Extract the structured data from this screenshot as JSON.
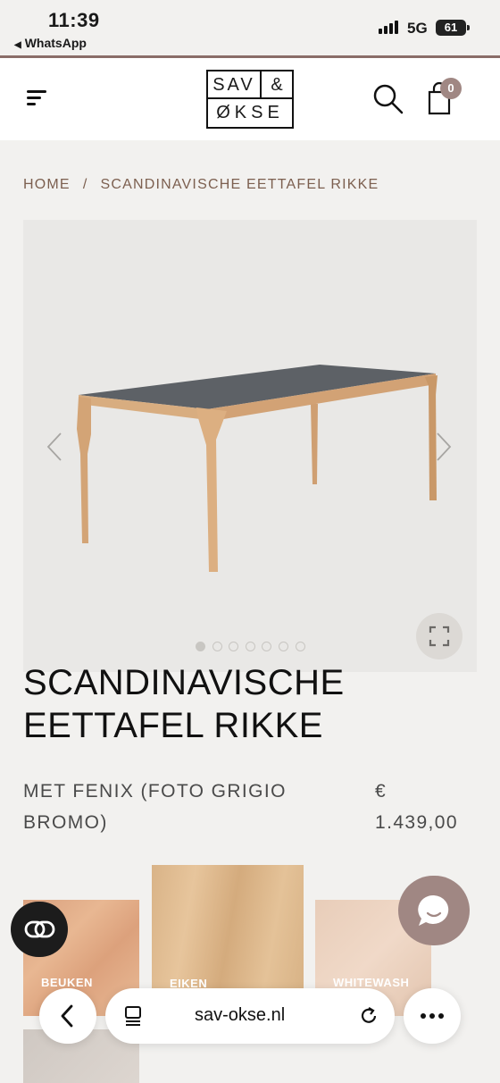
{
  "status_bar": {
    "time": "11:39",
    "back_app": "WhatsApp",
    "network": "5G",
    "battery": "61"
  },
  "header": {
    "logo_line1_left": "SAV",
    "logo_line1_right": "&",
    "logo_line2": "ØKSE",
    "cart_count": "0",
    "icons": [
      "menu-icon",
      "search-icon",
      "shopping-bag-icon"
    ]
  },
  "breadcrumb": {
    "home": "HOME",
    "separator": "/",
    "current": "SCANDINAVISCHE EETTAFEL RIKKE"
  },
  "gallery": {
    "slide_count": 7,
    "active_index": 0,
    "icons": [
      "chevron-left-icon",
      "chevron-right-icon",
      "fullscreen-icon"
    ]
  },
  "product": {
    "title_line1": "SCANDINAVISCHE",
    "title_line2": "EETTAFEL RIKKE",
    "variant_line1": "MET FENIX (FOTO GRIGIO",
    "variant_line2": "BROMO)",
    "price_currency": "€",
    "price_value": "1.439,00"
  },
  "swatches": [
    {
      "label": "BEUKEN"
    },
    {
      "label": "EIKEN"
    },
    {
      "label": "WHITEWASH"
    },
    {
      "label": ""
    }
  ],
  "browser": {
    "url": "sav-okse.nl",
    "icons": [
      "back-icon",
      "tabs-icon",
      "reload-icon",
      "more-icon"
    ]
  },
  "colors": {
    "accent": "#a08783",
    "breadcrumb": "#7c5f4f",
    "background": "#f2f1ef"
  }
}
